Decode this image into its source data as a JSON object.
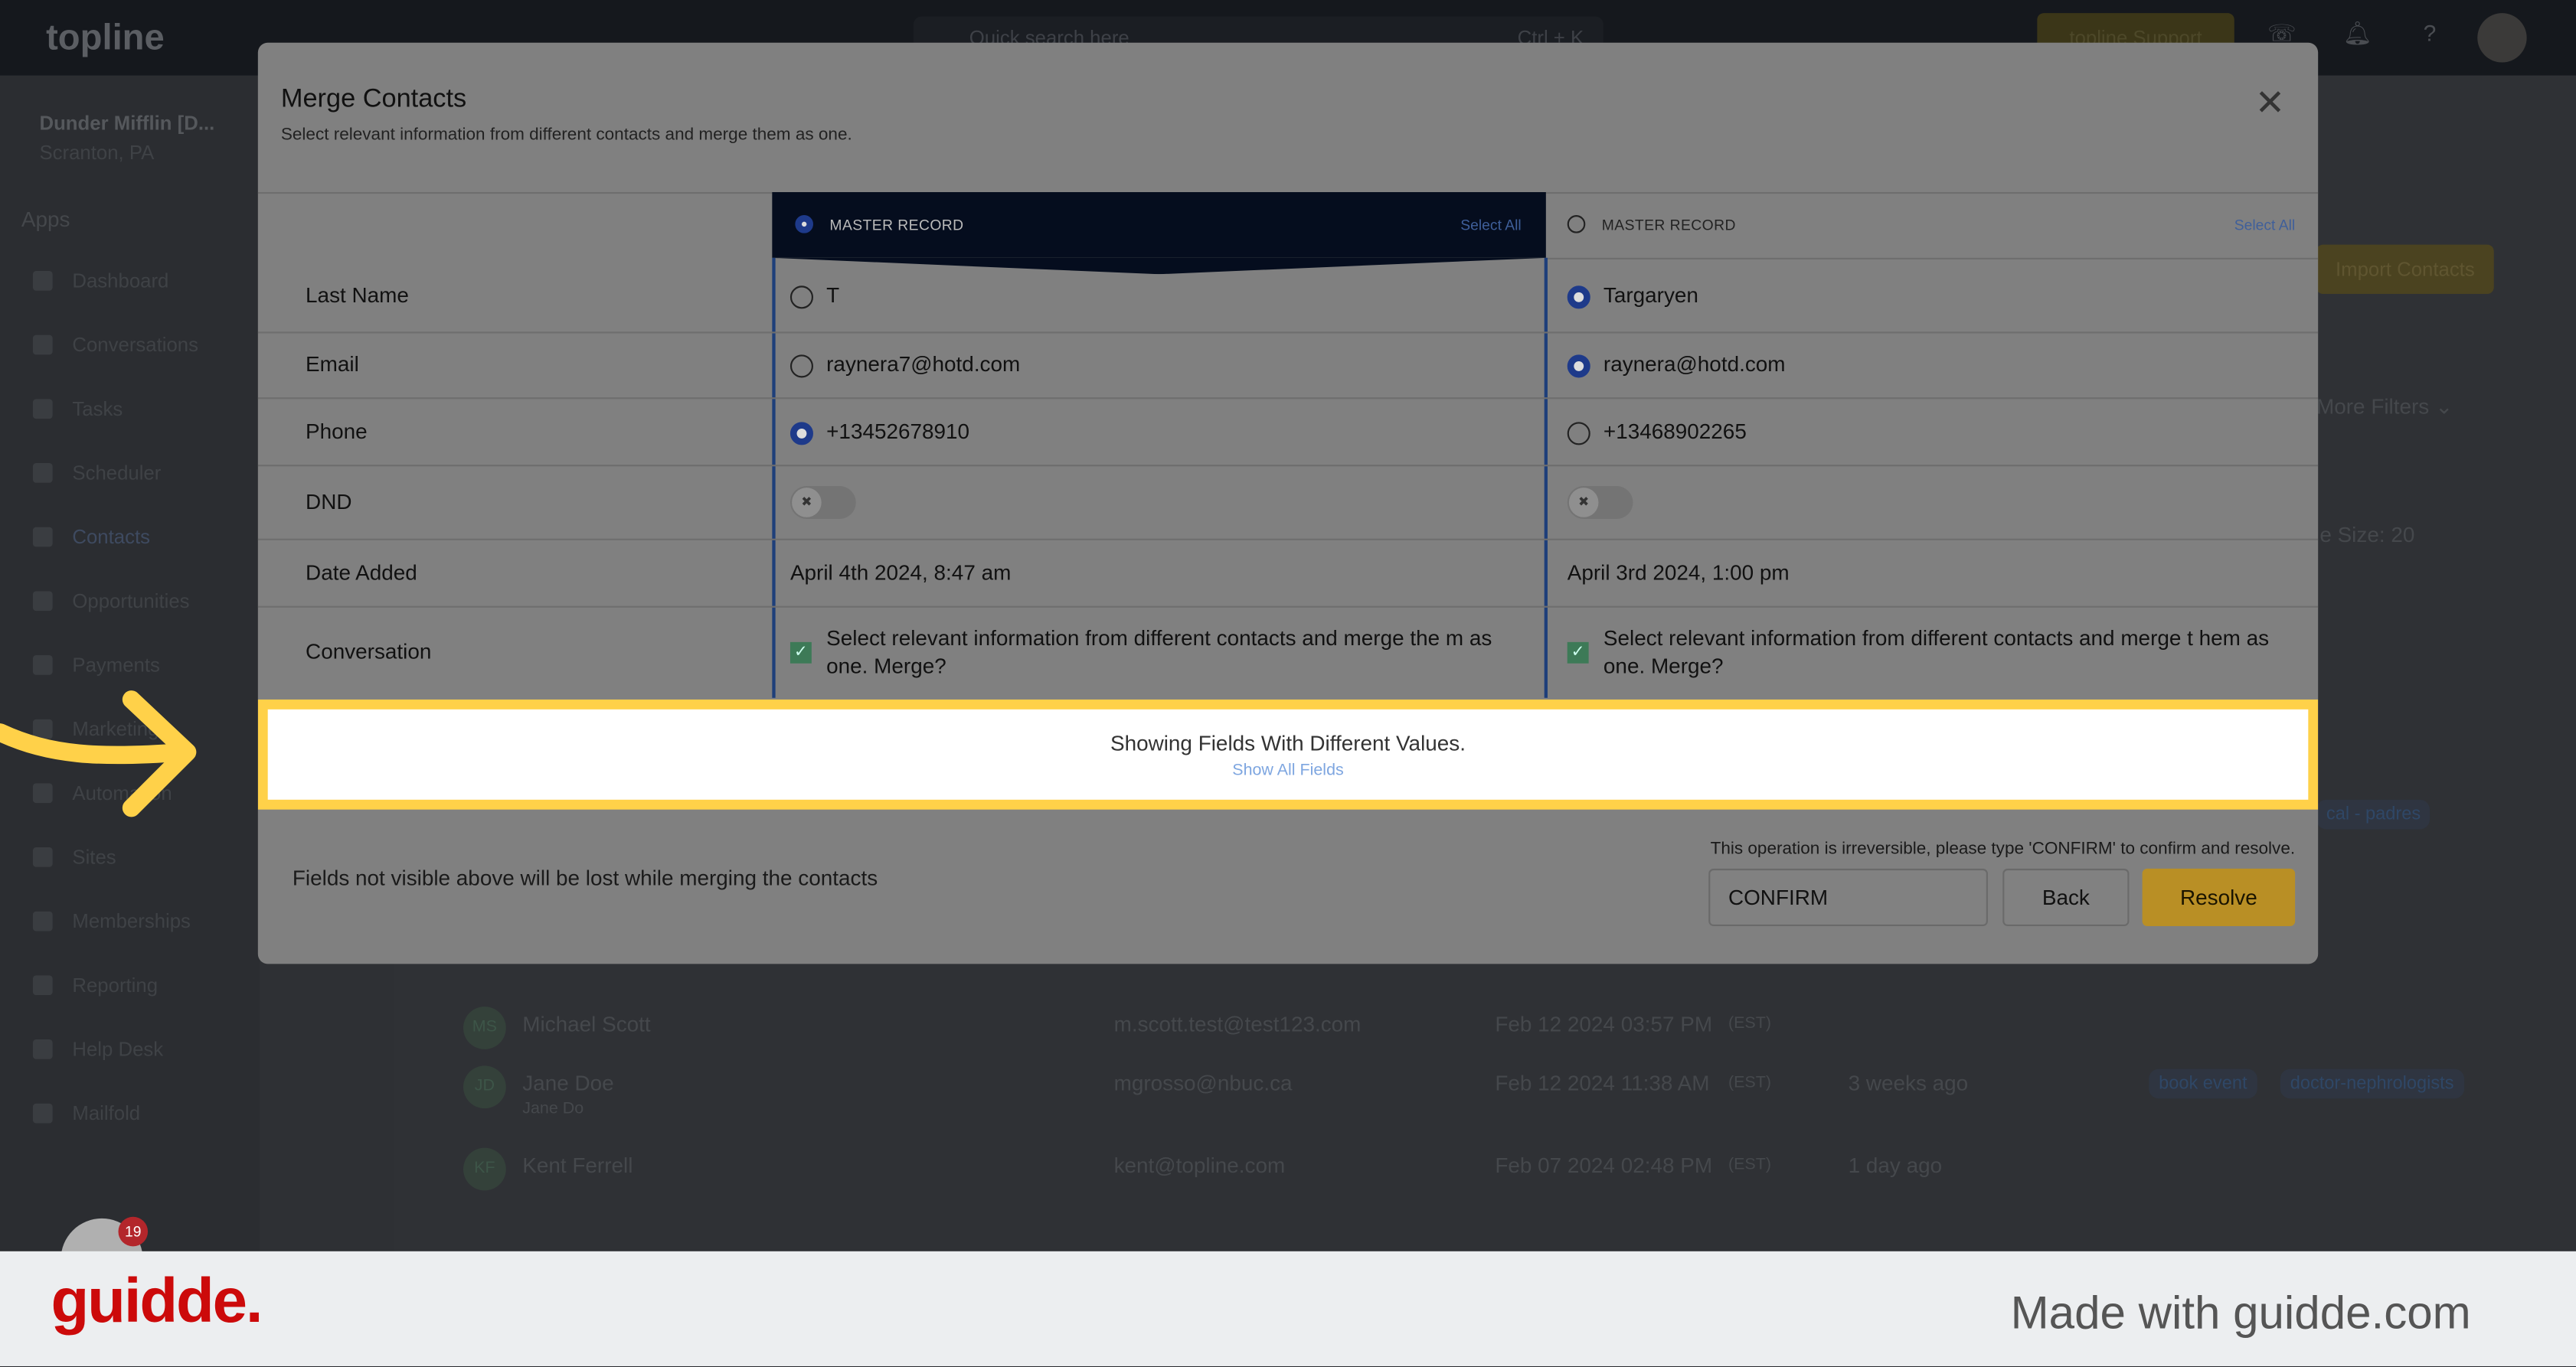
{
  "app": {
    "logo": "topline",
    "search_placeholder": "Quick search here",
    "search_shortcut": "Ctrl + K",
    "support_button": "topline Support"
  },
  "sidebar": {
    "account_name": "Dunder Mifflin [D...",
    "account_location": "Scranton, PA",
    "apps_label": "Apps",
    "items": [
      {
        "label": "Dashboard"
      },
      {
        "label": "Conversations"
      },
      {
        "label": "Tasks"
      },
      {
        "label": "Scheduler"
      },
      {
        "label": "Contacts",
        "active": true
      },
      {
        "label": "Opportunities"
      },
      {
        "label": "Payments"
      },
      {
        "label": "Marketing"
      },
      {
        "label": "Automation"
      },
      {
        "label": "Sites"
      },
      {
        "label": "Memberships"
      },
      {
        "label": "Reporting"
      },
      {
        "label": "Help Desk"
      },
      {
        "label": "Mailfold"
      }
    ],
    "notification_count": "19"
  },
  "background": {
    "import_contacts": "Import Contacts",
    "more_filters": "More Filters",
    "page_size": "e Size: 20",
    "chips_row1": [
      "cal - padres"
    ],
    "rows": [
      {
        "initials": "MS",
        "name": "Michael Scott",
        "email": "m.scott.test@test123.com",
        "date": "Feb 12 2024 03:57 PM",
        "tz": "(EST)",
        "activity": "",
        "tags": []
      },
      {
        "initials": "JD",
        "name": "Jane Doe",
        "sub": "Jane Do",
        "email": "mgrosso@nbuc.ca",
        "date": "Feb 12 2024 11:38 AM",
        "tz": "(EST)",
        "activity": "3 weeks ago",
        "tags": [
          "book event",
          "doctor-nephrologists"
        ]
      },
      {
        "initials": "KF",
        "name": "Kent Ferrell",
        "email": "kent@topline.com",
        "date": "Feb 07 2024 02:48 PM",
        "tz": "(EST)",
        "activity": "1 day ago",
        "tags": []
      }
    ]
  },
  "modal": {
    "title": "Merge Contacts",
    "subtitle": "Select relevant information from different contacts and merge them as one.",
    "columns": [
      {
        "header": "MASTER RECORD",
        "select_all": "Select All",
        "master": true
      },
      {
        "header": "MASTER RECORD",
        "select_all": "Select All",
        "master": false
      }
    ],
    "fields": [
      {
        "label": "Last Name",
        "values": [
          "T",
          "Targaryen"
        ],
        "selected": 1
      },
      {
        "label": "Email",
        "values": [
          "raynera7@hotd.com",
          "raynera@hotd.com"
        ],
        "selected": 1
      },
      {
        "label": "Phone",
        "values": [
          "+13452678910",
          "+13468902265"
        ],
        "selected": 0
      },
      {
        "label": "DND",
        "toggles": [
          false,
          false
        ]
      },
      {
        "label": "Date Added",
        "values": [
          "April 4th 2024, 8:47 am",
          "April 3rd 2024, 1:00 pm"
        ]
      },
      {
        "label": "Conversation",
        "values": [
          "Select relevant information from different contacts and merge the m as one. Merge?",
          "Select relevant information from different contacts and merge t hem as one. Merge?"
        ],
        "checked": [
          true,
          true
        ]
      }
    ],
    "diff_notice": "Showing Fields With Different Values.",
    "show_all_link": "Show All Fields",
    "lost_warning": "Fields not visible above will be lost while merging the contacts",
    "irreversible_note": "This operation is irreversible, please type 'CONFIRM' to confirm and resolve.",
    "confirm_value": "CONFIRM",
    "back_button": "Back",
    "resolve_button": "Resolve"
  },
  "colors": {
    "highlight": "#ffd149",
    "resolve": "#b98f25",
    "master_header": "#050d1e",
    "radio_selected": "#1e3a8a"
  },
  "footer": {
    "logo": "guidde.",
    "tagline": "Made with guidde.com"
  }
}
